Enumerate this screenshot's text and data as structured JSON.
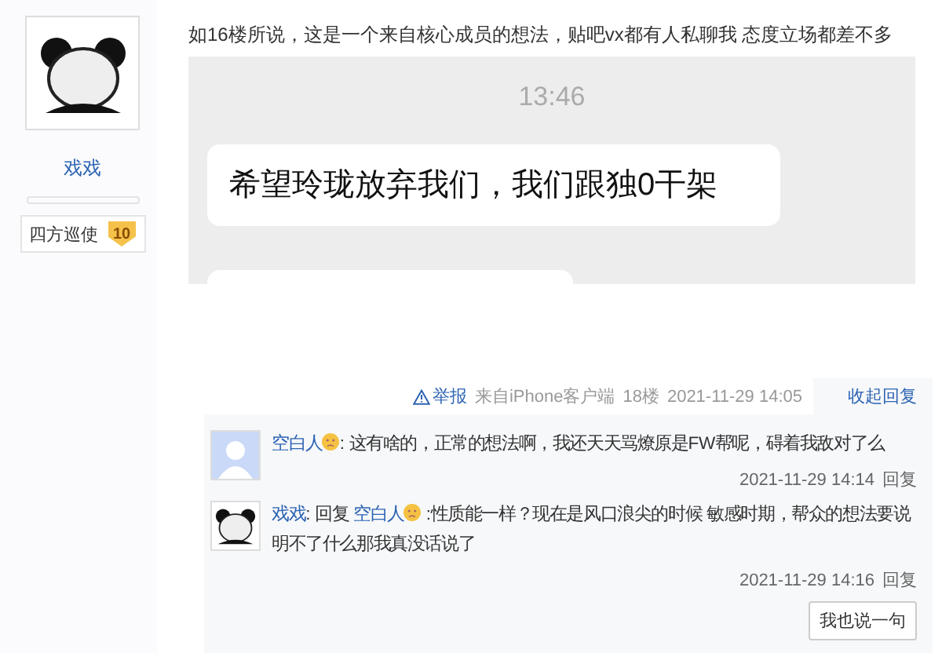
{
  "author": {
    "name": "戏戏",
    "badge": {
      "title": "四方巡使",
      "level": "10"
    }
  },
  "post": {
    "text": "如16楼所说，这是一个来自核心成员的想法，贴吧vx都有人私聊我 态度立场都差不多",
    "screenshot": {
      "time": "13:46",
      "messages": [
        "希望玲珑放弃我们，我们跟独0干架"
      ]
    },
    "footer": {
      "report": "举报",
      "client": "来自iPhone客户端",
      "floor": "18楼",
      "date": "2021-11-29 14:05",
      "toggle": "收起回复"
    }
  },
  "replies": [
    {
      "kind": "plain",
      "user": "空白人",
      "text": ": 这有啥的，正常的想法啊，我还天天骂燎原是FW帮呢，碍着我敌对了么",
      "date": "2021-11-29 14:14",
      "action": "回复"
    },
    {
      "kind": "reply",
      "user": "戏戏",
      "reply_word": ": 回复",
      "target": "空白人",
      "text": " :性质能一样？现在是风口浪尖的时候 敏感时期，帮众的想法要说明不了什么那我真没话说了",
      "date": "2021-11-29 14:16",
      "action": "回复"
    }
  ],
  "say_button": "我也说一句"
}
